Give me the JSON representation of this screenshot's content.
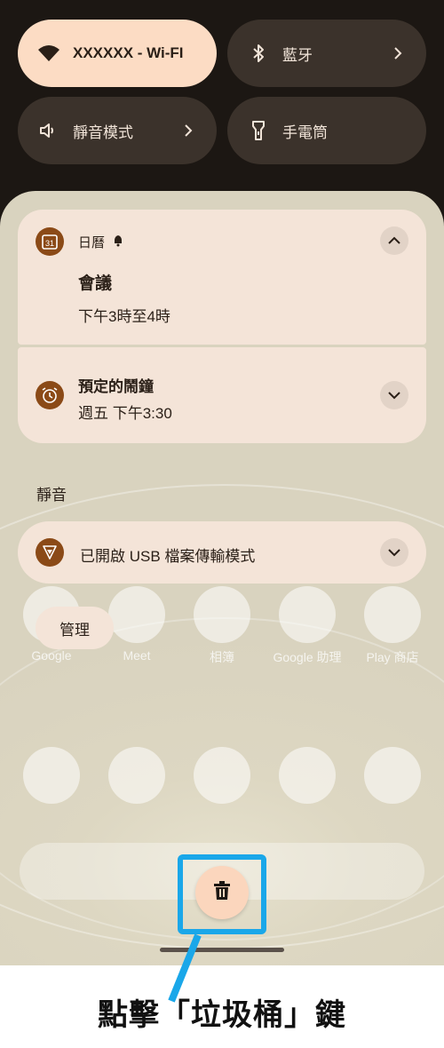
{
  "quick_settings": {
    "wifi": {
      "label": "XXXXXX - Wi-FI",
      "icon": "wifi-icon"
    },
    "bluetooth": {
      "label": "藍牙",
      "icon": "bluetooth-icon"
    },
    "silent": {
      "label": "靜音模式",
      "icon": "speaker-icon"
    },
    "flashlight": {
      "label": "手電筒",
      "icon": "flashlight-icon"
    }
  },
  "notifications": {
    "calendar": {
      "app": "日曆",
      "calendar_day": "31",
      "title": "會議",
      "time": "下午3時至4時"
    },
    "alarm": {
      "title": "預定的鬧鐘",
      "time": "週五 下午3:30"
    },
    "silent_section_label": "靜音",
    "usb": {
      "title": "已開啟 USB 檔案傳輸模式"
    }
  },
  "manage_button": {
    "label": "管理"
  },
  "home_apps": {
    "google": "Google",
    "meet": "Meet",
    "photos": "相簿",
    "assistant": "Google 助理",
    "play": "Play 商店"
  },
  "trash_button": {
    "icon": "trash-icon"
  },
  "caption": "點擊「垃圾桶」鍵",
  "colors": {
    "accent_highlight": "#1aa7e9",
    "app_icon": "#8b4a17",
    "wifi_tile": "#fcdcc4",
    "card": "#f4e4d8"
  }
}
